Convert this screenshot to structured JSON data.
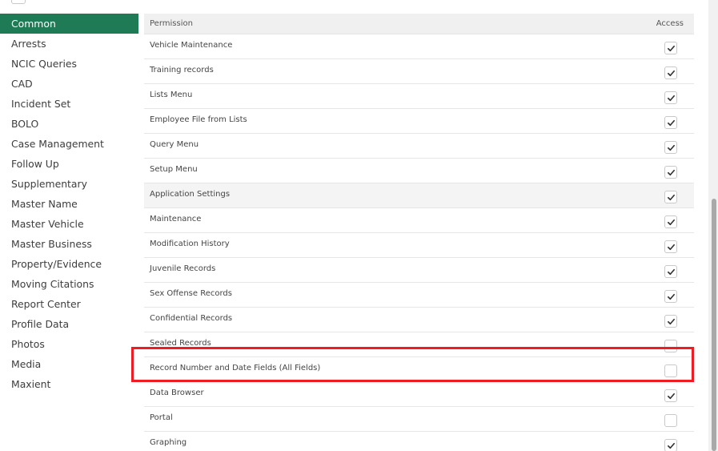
{
  "sidebar": {
    "items": [
      {
        "label": "Common",
        "active": true
      },
      {
        "label": "Arrests"
      },
      {
        "label": "NCIC Queries"
      },
      {
        "label": "CAD"
      },
      {
        "label": "Incident Set"
      },
      {
        "label": "BOLO"
      },
      {
        "label": "Case Management"
      },
      {
        "label": "Follow Up"
      },
      {
        "label": "Supplementary"
      },
      {
        "label": "Master Name"
      },
      {
        "label": "Master Vehicle"
      },
      {
        "label": "Master Business"
      },
      {
        "label": "Property/Evidence"
      },
      {
        "label": "Moving Citations"
      },
      {
        "label": "Report Center"
      },
      {
        "label": "Profile Data"
      },
      {
        "label": "Photos"
      },
      {
        "label": "Media"
      },
      {
        "label": "Maxient"
      }
    ]
  },
  "table": {
    "header": {
      "permission": "Permission",
      "access": "Access"
    },
    "rows": [
      {
        "label": "Vehicle Maintenance",
        "checked": true
      },
      {
        "label": "Training records",
        "checked": true
      },
      {
        "label": "Lists Menu",
        "checked": true
      },
      {
        "label": "Employee File from Lists",
        "checked": true
      },
      {
        "label": "Query Menu",
        "checked": true
      },
      {
        "label": "Setup Menu",
        "checked": true
      },
      {
        "label": "Application Settings",
        "checked": true,
        "shaded": true
      },
      {
        "label": "Maintenance",
        "checked": true
      },
      {
        "label": "Modification History",
        "checked": true
      },
      {
        "label": "Juvenile Records",
        "checked": true
      },
      {
        "label": "Sex Offense Records",
        "checked": true
      },
      {
        "label": "Confidential Records",
        "checked": true
      },
      {
        "label": "Sealed Records",
        "checked": false
      },
      {
        "label": "Record Number and Date Fields (All Fields)",
        "checked": false
      },
      {
        "label": "Data Browser",
        "checked": true
      },
      {
        "label": "Portal",
        "checked": false
      },
      {
        "label": "Graphing",
        "checked": true
      }
    ]
  },
  "colors": {
    "accent": "#1e7b55",
    "highlight": "#ee1c24"
  },
  "icons": {
    "check": "checkmark-icon"
  }
}
